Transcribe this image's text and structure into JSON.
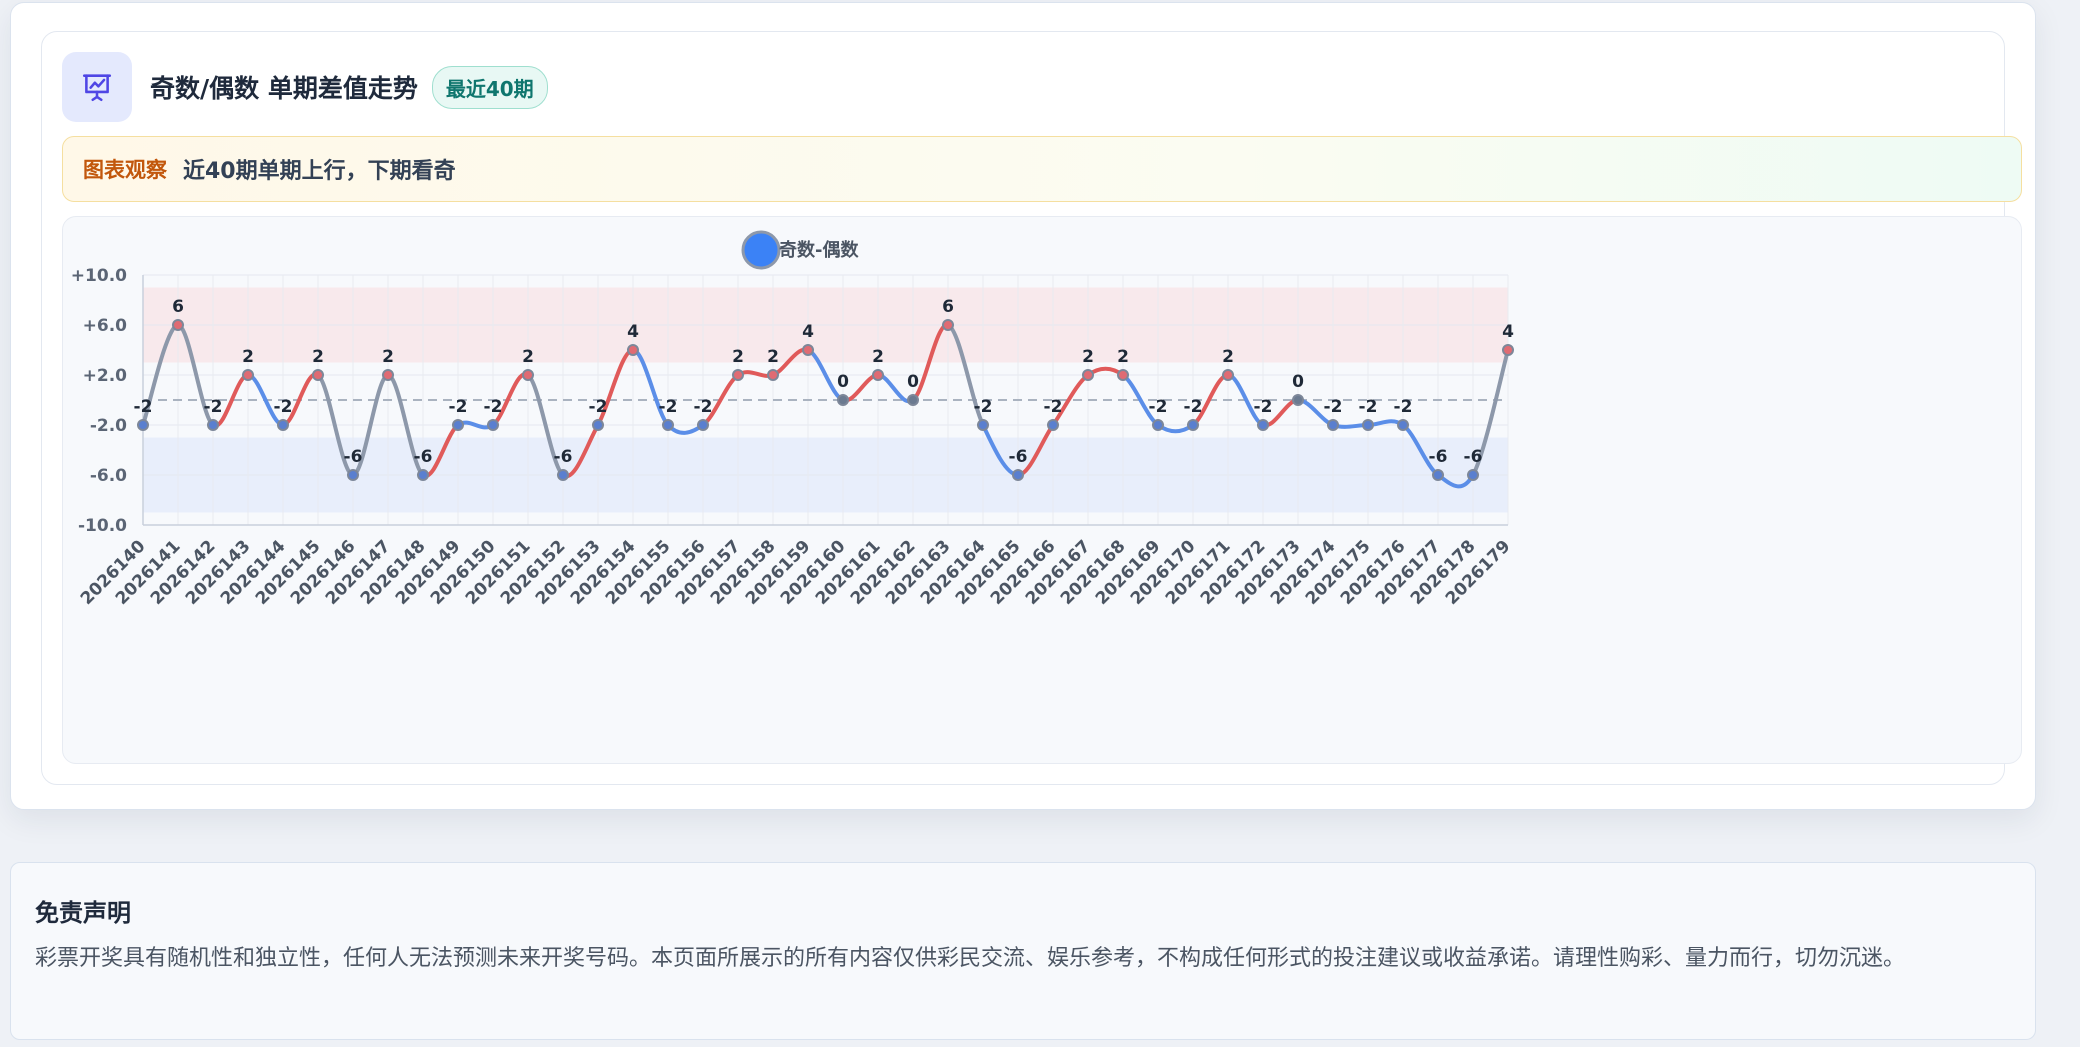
{
  "header": {
    "title": "奇数/偶数 单期差值走势",
    "badge": "最近40期",
    "icon": "presentation-chart-icon"
  },
  "observation": {
    "label": "图表观察",
    "text": "近40期单期上行，下期看奇"
  },
  "disclaimer": {
    "title": "免责声明",
    "text": "彩票开奖具有随机性和独立性，任何人无法预测未来开奖号码。本页面所展示的所有内容仅供彩民交流、娱乐参考，不构成任何形式的投注建议或收益承诺。请理性购彩、量力而行，切勿沉迷。"
  },
  "colors": {
    "up": "#e05a5a",
    "down": "#5b8ee8",
    "neutral": "#8d98aa",
    "legend": "#3b82f6",
    "band_high": "#f8e9ec",
    "band_low": "#e8eefb"
  },
  "chart_data": {
    "type": "line",
    "legend": {
      "label": "奇数-偶数",
      "position": "top"
    },
    "categories": [
      "2026140",
      "2026141",
      "2026142",
      "2026143",
      "2026144",
      "2026145",
      "2026146",
      "2026147",
      "2026148",
      "2026149",
      "2026150",
      "2026151",
      "2026152",
      "2026153",
      "2026154",
      "2026155",
      "2026156",
      "2026157",
      "2026158",
      "2026159",
      "2026160",
      "2026161",
      "2026162",
      "2026163",
      "2026164",
      "2026165",
      "2026166",
      "2026167",
      "2026168",
      "2026169",
      "2026170",
      "2026171",
      "2026172",
      "2026173",
      "2026174",
      "2026175",
      "2026176",
      "2026177",
      "2026178",
      "2026179"
    ],
    "series": [
      {
        "name": "奇数-偶数",
        "values": [
          -2,
          6,
          -2,
          2,
          -2,
          2,
          -6,
          2,
          -6,
          -2,
          -2,
          2,
          -6,
          -2,
          4,
          -2,
          -2,
          2,
          2,
          4,
          0,
          2,
          0,
          6,
          -2,
          -6,
          -2,
          2,
          2,
          -2,
          -2,
          2,
          -2,
          0,
          -2,
          -2,
          -2,
          -6,
          -6,
          4
        ]
      }
    ],
    "ylim": [
      -10,
      10
    ],
    "yticks": [
      10,
      6,
      2,
      -2,
      -6,
      -10
    ],
    "ytick_labels": [
      "+10.0",
      "+6.0",
      "+2.0",
      "-2.0",
      "-6.0",
      "-10.0"
    ],
    "bands": [
      {
        "from": 3,
        "to": 9,
        "tone": "high"
      },
      {
        "from": -9,
        "to": -3,
        "tone": "low"
      }
    ],
    "reference_line": 0,
    "grid": true
  }
}
